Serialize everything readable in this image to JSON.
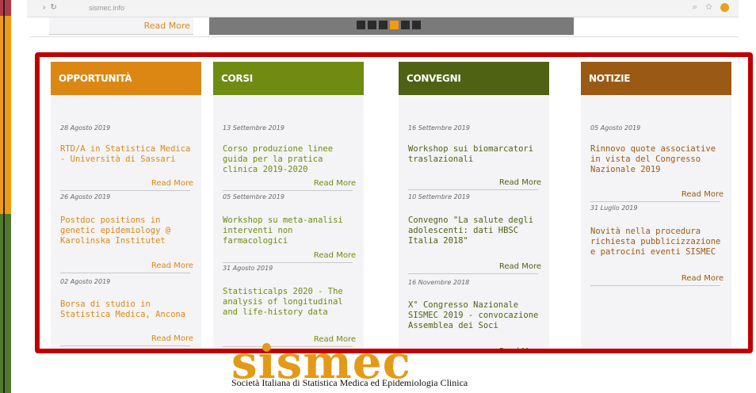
{
  "browser": {
    "url": "sismec.info"
  },
  "top": {
    "read_more": "Read More"
  },
  "colors": {
    "opportunita": "#dc8714",
    "corsi": "#6f8b12",
    "convegni": "#4f6214",
    "notizie": "#9b5a13",
    "frame": "#c00000"
  },
  "columns": [
    {
      "title": "OPPORTUNITÀ",
      "items": [
        {
          "date": "28 Agosto 2019",
          "title": "RTD/A in Statistica Medica - Università di Sassari",
          "read_more": "Read More"
        },
        {
          "date": "26 Agosto 2019",
          "title": "Postdoc positions in genetic epidemiology @ Karolinska Institutet",
          "read_more": "Read More"
        },
        {
          "date": "02 Agosto 2019",
          "title": "Borsa di studio in Statistica Medica, Ancona",
          "read_more": "Read More"
        }
      ]
    },
    {
      "title": "CORSI",
      "items": [
        {
          "date": "13 Settembre 2019",
          "title": "Corso produzione linee guida per la pratica clinica 2019-2020",
          "read_more": "Read More"
        },
        {
          "date": "05 Settembre 2019",
          "title": "Workshop su meta-analisi interventi non farmacologici",
          "read_more": "Read More"
        },
        {
          "date": "31 Agosto 2019",
          "title": "Statisticalps 2020 - The analysis of longitudinal and life-history data",
          "read_more": "Read More"
        }
      ]
    },
    {
      "title": "CONVEGNI",
      "items": [
        {
          "date": "16 Settembre 2019",
          "title": "Workshop sui biomarcatori traslazionali",
          "read_more": "Read More"
        },
        {
          "date": "10 Settembre 2019",
          "title": "Convegno \"La salute degli adolescenti: dati HBSC Italia 2018\"",
          "read_more": "Read More"
        },
        {
          "date": "16 Novembre 2018",
          "title": "X° Congresso Nazionale SISMEC 2019 - convocazione Assemblea dei Soci",
          "read_more": "Read More"
        }
      ]
    },
    {
      "title": "NOTIZIE",
      "items": [
        {
          "date": "05 Agosto 2019",
          "title": "Rinnovo quote associative in vista del Congresso Nazionale 2019",
          "read_more": "Read More"
        },
        {
          "date": "31 Luglio 2019",
          "title": "Novità nella procedura richiesta pubblicizzazione e patrocini eventi SISMEC",
          "read_more": "Read More"
        }
      ]
    }
  ],
  "logo": {
    "wordmark": "sismec",
    "subtitle": "Società Italiana di Statistica Medica ed Epidemiologia Clinica"
  }
}
